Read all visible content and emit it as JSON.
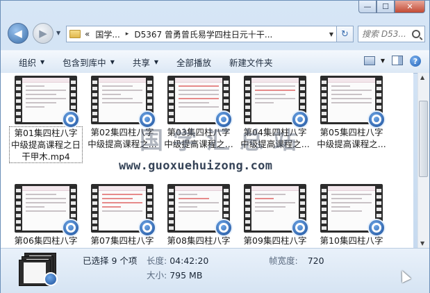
{
  "window": {
    "minimize_glyph": "—",
    "maximize_glyph": "☐",
    "close_glyph": "✕"
  },
  "nav": {
    "back_glyph": "◀",
    "forward_glyph": "▶",
    "address_prefix": "«",
    "breadcrumb": [
      "国学...",
      "D5367 曾勇曾氏易学四柱日元十干..."
    ],
    "breadcrumb_sep": "▸",
    "refresh_glyph": "↻",
    "search_placeholder": "搜索 D53..."
  },
  "toolbar": {
    "items": [
      {
        "label": "组织",
        "dropdown": true
      },
      {
        "label": "包含到库中",
        "dropdown": true
      },
      {
        "label": "共享",
        "dropdown": true
      },
      {
        "label": "全部播放",
        "dropdown": false
      },
      {
        "label": "新建文件夹",
        "dropdown": false
      }
    ],
    "dropdown_glyph": "▼",
    "help_glyph": "?"
  },
  "files": {
    "row1": [
      {
        "name": "第01集四柱八字中级提高课程之日干甲木.mp4",
        "line1": "第01集四柱八字",
        "line2": "中级提高课程之日",
        "line3": "干甲木.mp4"
      },
      {
        "name": "第02集",
        "line1": "第02集四柱八字",
        "line2": "中级提高课程之..."
      },
      {
        "name": "第03集",
        "line1": "第03集四柱八字",
        "line2": "中级提高课程之..."
      },
      {
        "name": "第04集",
        "line1": "第04集四柱八字",
        "line2": "中级提高课程之..."
      },
      {
        "name": "第05集",
        "line1": "第05集四柱八字",
        "line2": "中级提高课程之..."
      }
    ],
    "row2": [
      {
        "line1": "第06集四柱八字"
      },
      {
        "line1": "第07集四柱八字"
      },
      {
        "line1": "第08集四柱八字"
      },
      {
        "line1": "第09集四柱八字"
      },
      {
        "line1": "第10集四柱八字"
      }
    ]
  },
  "watermark": {
    "big": "国学汇总站",
    "url": "www.guoxuehuizong.com"
  },
  "details": {
    "selected": "已选择 9 个项",
    "length_key": "长度:",
    "length_val": "04:42:20",
    "size_key": "大小:",
    "size_val": "795 MB",
    "framewidth_key": "帧宽度:",
    "framewidth_val": "720"
  }
}
